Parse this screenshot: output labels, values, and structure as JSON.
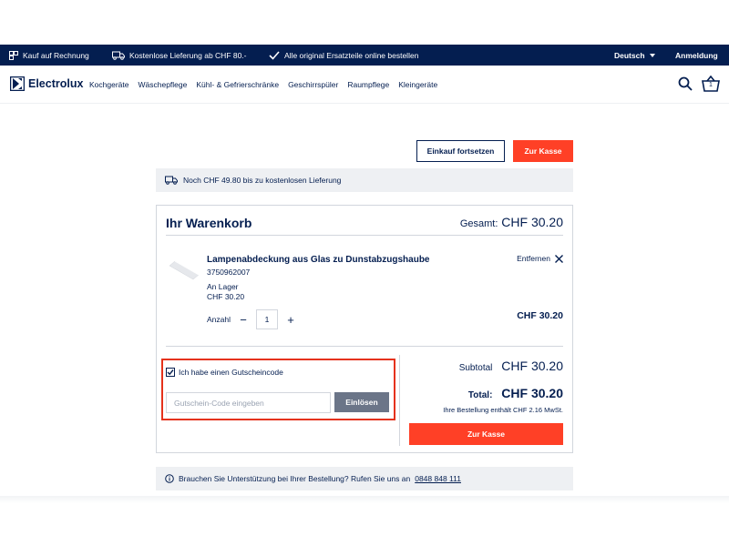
{
  "topbar": {
    "invoice": "Kauf auf Rechnung",
    "delivery": "Kostenlose Lieferung ab CHF 80.-",
    "parts": "Alle original Ersatzteile online bestellen",
    "language": "Deutsch",
    "login": "Anmeldung"
  },
  "nav": {
    "brand": "Electrolux",
    "menu": [
      "Kochgeräte",
      "Wäschepflege",
      "Kühl- & Gefrierschränke",
      "Geschirrspüler",
      "Raumpflege",
      "Kleingeräte"
    ],
    "cart_count": "1"
  },
  "actions": {
    "continue_label": "Einkauf fortsetzen",
    "checkout_label": "Zur Kasse"
  },
  "shipping_notice": "Noch CHF 49.80 bis zu kostenlosen Lieferung",
  "cart": {
    "title": "Ihr Warenkorb",
    "total_label": "Gesamt:",
    "total_value": "CHF 30.20",
    "item": {
      "name": "Lampenabdeckung aus Glas zu Dunstabzugshaube",
      "sku": "3750962007",
      "stock": "An Lager",
      "unit_price": "CHF 30.20",
      "remove_label": "Entfernen",
      "qty_label": "Anzahl",
      "qty_minus": "−",
      "qty_value": "1",
      "qty_plus": "+",
      "line_price": "CHF 30.20"
    },
    "coupon": {
      "checkbox_label": "Ich habe einen Gutscheincode",
      "placeholder": "Gutschein-Code eingeben",
      "redeem_label": "Einlösen"
    },
    "summary": {
      "subtotal_label": "Subtotal",
      "subtotal_value": "CHF 30.20",
      "total_label": "Total:",
      "total_value": "CHF 30.20",
      "vat_note": "Ihre Bestellung enthält CHF 2.16 MwSt.",
      "checkout_label": "Zur Kasse"
    }
  },
  "help": {
    "text": "Brauchen Sie Unterstützung bei Ihrer Bestellung? Rufen Sie uns an",
    "phone": "0848 848 111"
  },
  "colors": {
    "navy": "#041e50",
    "accent_red": "#ff4026",
    "highlight_red": "#e5321b",
    "grey_button": "#6b7588",
    "light_bg": "#eef0f3"
  }
}
